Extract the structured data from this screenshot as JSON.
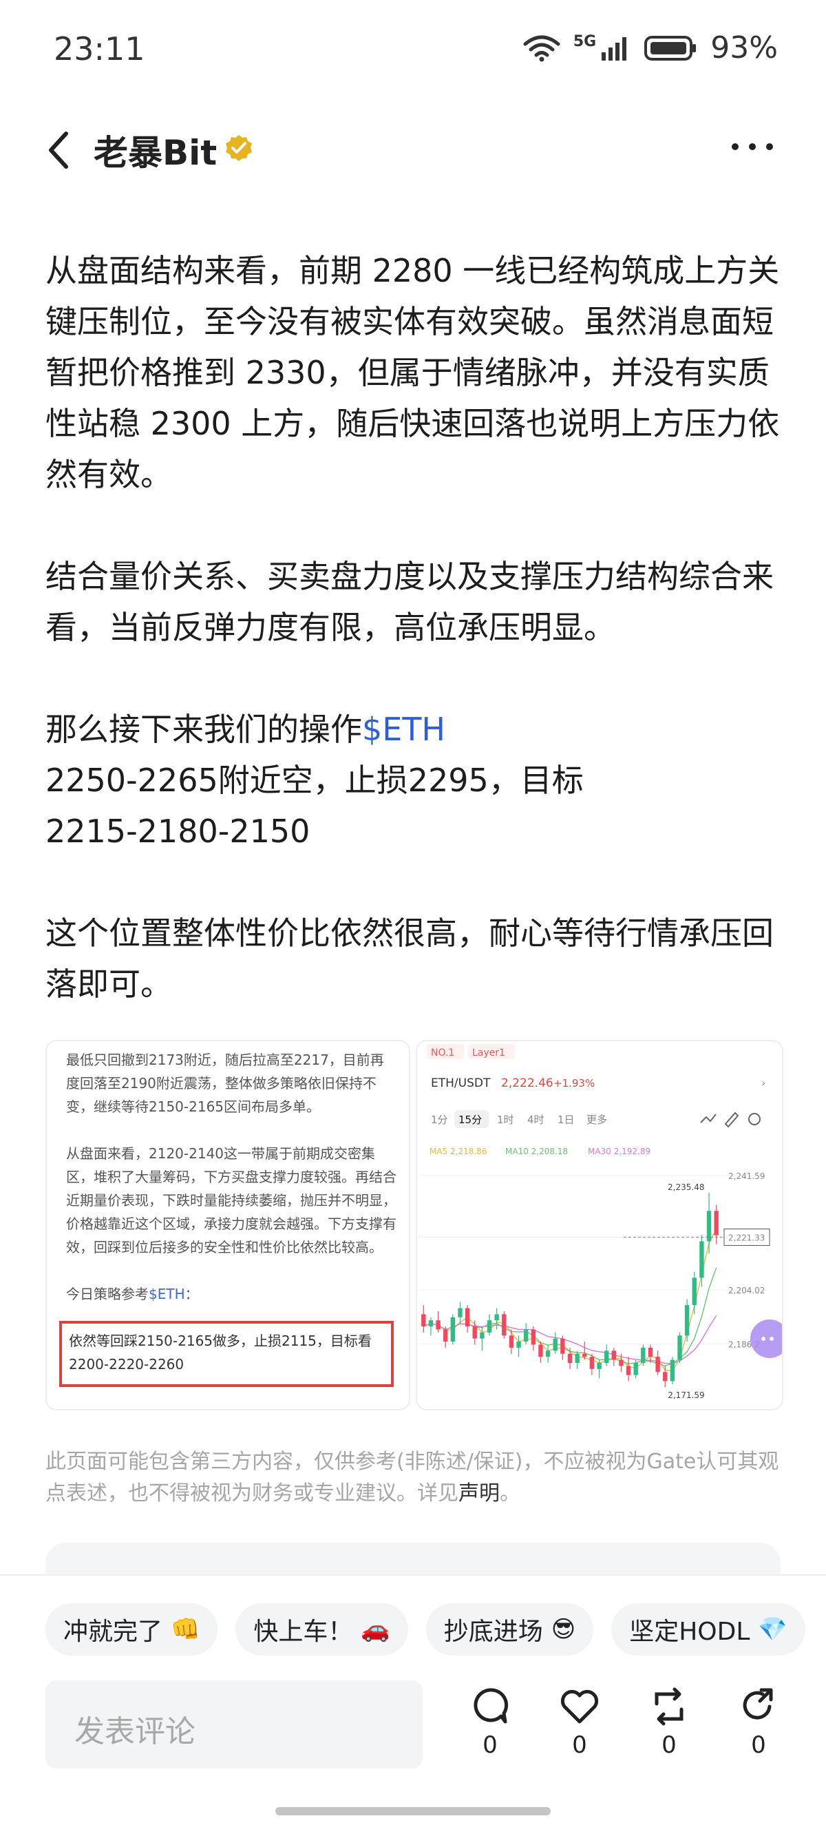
{
  "status_bar": {
    "time": "23:11",
    "network": "5G",
    "battery_percent": "93%"
  },
  "header": {
    "author": "老暴Bit",
    "verified_color": "#e6b422"
  },
  "post": {
    "paragraph1": "从盘面结构来看，前期 2280 一线已经构筑成上方关键压制位，至今没有被实体有效突破。虽然消息面短暂把价格推到 2330，但属于情绪脉冲，并没有实质性站稳 2300 上方，随后快速回落也说明上方压力依然有效。",
    "paragraph2": "结合量价关系、买卖盘力度以及支撑压力结构综合来看，当前反弹力度有限，高位承压明显。",
    "line3_prefix": "那么接下来我们的操作",
    "cashtag": "$ETH",
    "line4": "2250-2265附近空，止损2295，目标",
    "line5": "2215-2180-2150",
    "paragraph4": "这个位置整体性价比依然很高，耐心等待行情承压回落即可。"
  },
  "image_left": {
    "p1": "最低只回撤到2173附近，随后拉高至2217，目前再度回落至2190附近震荡，整体做多策略依旧保持不变，继续等待2150-2165区间布局多单。",
    "p2": "从盘面来看，2120-2140这一带属于前期成交密集区，堆积了大量筹码，下方买盘支撑力度较强。再结合近期量价表现，下跌时量能持续萎缩，抛压并不明显，价格越靠近这个区域，承接力度就会越强。下方支撑有效，回踩到位后接多的安全性和性价比依然比较高。",
    "strategy_prefix": "今日策略参考",
    "strategy_tag": "$ETH",
    "strategy_suffix": "：",
    "boxed": "依然等回踩2150-2165做多，止损2115，目标看2200-2220-2260"
  },
  "image_right": {
    "top_tags": [
      "NO.1",
      "Layer1"
    ],
    "pair": "ETH/USDT",
    "price": "2,222.46",
    "change": "+1.93%",
    "tabs": [
      "1分",
      "15分",
      "1时",
      "4时",
      "1日",
      "更多"
    ],
    "active_tab": 1,
    "ma": [
      "MA5 2,218.86",
      "MA10 2,208.18",
      "MA30 2,192.89"
    ],
    "high_label": "2,235.48",
    "axis": [
      "2,241.59",
      "2,221.33",
      "2,204.02",
      "2,186.2"
    ],
    "low_label": "2,171.59"
  },
  "chart_data": {
    "type": "candlestick",
    "title": "ETH/USDT",
    "interval": "15分",
    "yticks": [
      "2,241.59",
      "2,221.33",
      "2,204.02",
      "2,186.2"
    ],
    "ylim": [
      2168,
      2245
    ],
    "annotations": {
      "high": "2,235.48",
      "current": "2,221.33",
      "low": "2,171.59"
    },
    "candles": [
      [
        2196,
        2199,
        2190,
        2192
      ],
      [
        2192,
        2195,
        2189,
        2194
      ],
      [
        2194,
        2197,
        2190,
        2191
      ],
      [
        2191,
        2192,
        2185,
        2187
      ],
      [
        2187,
        2196,
        2186,
        2195
      ],
      [
        2195,
        2200,
        2193,
        2198
      ],
      [
        2198,
        2199,
        2190,
        2192
      ],
      [
        2192,
        2194,
        2186,
        2188
      ],
      [
        2188,
        2192,
        2184,
        2190
      ],
      [
        2190,
        2196,
        2189,
        2194
      ],
      [
        2194,
        2198,
        2191,
        2196
      ],
      [
        2196,
        2197,
        2188,
        2189
      ],
      [
        2189,
        2191,
        2183,
        2185
      ],
      [
        2185,
        2189,
        2182,
        2187
      ],
      [
        2187,
        2193,
        2186,
        2191
      ],
      [
        2191,
        2192,
        2184,
        2186
      ],
      [
        2186,
        2187,
        2180,
        2182
      ],
      [
        2182,
        2186,
        2180,
        2184
      ],
      [
        2184,
        2190,
        2183,
        2188
      ],
      [
        2188,
        2189,
        2181,
        2183
      ],
      [
        2183,
        2185,
        2178,
        2180
      ],
      [
        2180,
        2184,
        2178,
        2183
      ],
      [
        2183,
        2187,
        2181,
        2182
      ],
      [
        2182,
        2183,
        2176,
        2178
      ],
      [
        2178,
        2181,
        2175,
        2180
      ],
      [
        2180,
        2186,
        2179,
        2184
      ],
      [
        2184,
        2185,
        2179,
        2181
      ],
      [
        2181,
        2183,
        2177,
        2179
      ],
      [
        2179,
        2182,
        2174,
        2176
      ],
      [
        2176,
        2181,
        2175,
        2180
      ],
      [
        2180,
        2186,
        2179,
        2185
      ],
      [
        2185,
        2186,
        2180,
        2182
      ],
      [
        2182,
        2184,
        2176,
        2177
      ],
      [
        2177,
        2179,
        2172,
        2174
      ],
      [
        2174,
        2182,
        2173,
        2181
      ],
      [
        2181,
        2190,
        2180,
        2189
      ],
      [
        2189,
        2201,
        2187,
        2199
      ],
      [
        2199,
        2210,
        2196,
        2208
      ],
      [
        2208,
        2222,
        2205,
        2220
      ],
      [
        2220,
        2236,
        2216,
        2230
      ],
      [
        2230,
        2232,
        2219,
        2222
      ]
    ],
    "ma_colors": [
      "#e8b93a",
      "#6cc36b",
      "#d87ad6"
    ]
  },
  "disclaimer": {
    "text": "此页面可能包含第三方内容，仅供参考(非陈述/保证)，不应被视为Gate认可其观点表述，也不得被视为财务或专业建议。详见",
    "link": "声明",
    "end": "。"
  },
  "chips": [
    {
      "label": "冲就完了",
      "emoji": "👊"
    },
    {
      "label": "快上车！",
      "emoji": "🚗"
    },
    {
      "label": "抄底进场",
      "emoji": "😎"
    },
    {
      "label": "坚定HODL",
      "emoji": "💎"
    }
  ],
  "comment": {
    "placeholder": "发表评论"
  },
  "actions": {
    "comment_count": "0",
    "like_count": "0",
    "repost_count": "0",
    "share_count": "0"
  }
}
